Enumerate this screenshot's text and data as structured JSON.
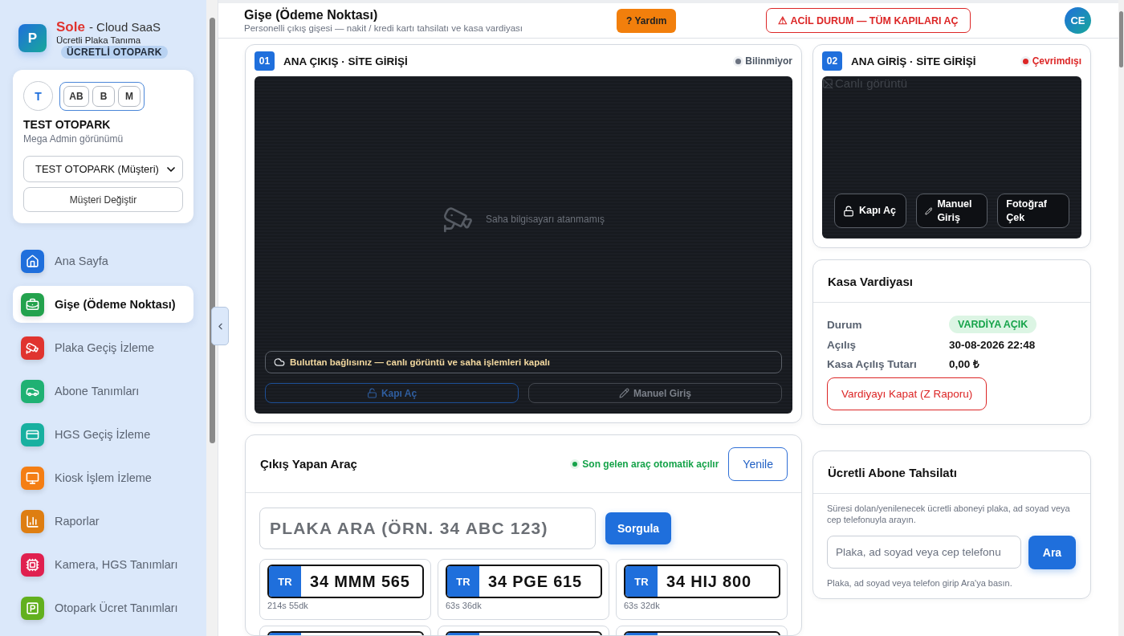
{
  "sidebar": {
    "logo_letter": "P",
    "brand_name": "Sole",
    "brand_suffix": "- Cloud SaaS",
    "product": "Ücretli Plaka Tanıma",
    "plan_badge": "ÜCRETLİ OTOPARK",
    "account": {
      "avatar": "T",
      "view_buttons": [
        "AB",
        "B",
        "M"
      ],
      "view_switch_active": true,
      "title": "TEST OTOPARK",
      "subtitle": "Mega Admin görünümü",
      "customer_select": {
        "value": "TEST OTOPARK (Müşteri)"
      },
      "change_button": "Müşteri Değiştir"
    },
    "nav": [
      {
        "label": "Ana Sayfa",
        "color": "#1f6fdc",
        "selected": false
      },
      {
        "label": "Gişe (Ödeme Noktası)",
        "color": "#23a24d",
        "selected": true
      },
      {
        "label": "Plaka Geçiş İzleme",
        "color": "#e0342f",
        "selected": false
      },
      {
        "label": "Abone Tanımları",
        "color": "#1fb173",
        "selected": false
      },
      {
        "label": "HGS Geçiş İzleme",
        "color": "#18b0a0",
        "selected": false
      },
      {
        "label": "Kiosk İşlem İzleme",
        "color": "#f47e14",
        "selected": false
      },
      {
        "label": "Raporlar",
        "color": "#de7e12",
        "selected": false
      },
      {
        "label": "Kamera, HGS Tanımları",
        "color": "#e0204f",
        "selected": false
      },
      {
        "label": "Otopark Ücret Tanımları",
        "color": "#62b01e",
        "selected": false
      }
    ]
  },
  "header": {
    "title": "Gişe (Ödeme Noktası)",
    "subtitle": "Personelli çıkış gişesi — nakit / kredi kartı tahsilatı ve kasa vardiyası",
    "help_button": "? Yardım",
    "emergency_button": "⚠ ACİL DURUM — TÜM KAPILARI AÇ",
    "user_avatar": "CE"
  },
  "cameras": [
    {
      "number": "01",
      "name": "ANA ÇIKIŞ · SİTE GİRİŞİ",
      "status": {
        "label": "Bilinmiyor",
        "color": "#6b7280"
      },
      "feed": {
        "kind": "placeholder",
        "message": "Saha bilgisayarı atanmamış"
      },
      "notice": "Buluttan bağlısınız — canlı görüntü ve saha işlemleri kapalı",
      "actions": [
        {
          "label": "Kapı Aç",
          "kind": "open",
          "disabled": true
        },
        {
          "label": "Manuel Giriş",
          "kind": "manual",
          "disabled": true
        }
      ]
    },
    {
      "number": "02",
      "name": "ANA GİRİŞ · SİTE GİRİŞİ",
      "status": {
        "label": "Çevrimdışı",
        "color": "#dc2626"
      },
      "feed": {
        "kind": "broken",
        "alt": "Canlı görüntü"
      },
      "actions": [
        {
          "label": "Kapı Aç",
          "kind": "open",
          "disabled": false
        },
        {
          "label": "Manuel Giriş",
          "kind": "manual",
          "disabled": false
        },
        {
          "label": "Fotoğraf Çek",
          "kind": "photo",
          "disabled": false
        }
      ]
    }
  ],
  "exit_vehicle": {
    "title": "Çıkış Yapan Araç",
    "auto_note": "Son gelen araç otomatik açılır",
    "refresh_button": "Yenile",
    "search": {
      "placeholder": "PLAKA ARA (ÖRN. 34 ABC 123)"
    },
    "query_button": "Sorgula",
    "plates": [
      {
        "kind": "full",
        "country": "TR",
        "number": "34 MMM 565",
        "elapsed": "214s 55dk"
      },
      {
        "kind": "full",
        "country": "TR",
        "number": "34 PGE 615",
        "elapsed": "63s 36dk"
      },
      {
        "kind": "full",
        "country": "TR",
        "number": "34 HIJ 800",
        "elapsed": "63s 32dk"
      },
      {
        "kind": "cut"
      },
      {
        "kind": "cut"
      },
      {
        "kind": "cut"
      }
    ]
  },
  "cash_shift": {
    "title": "Kasa Vardiyası",
    "rows": [
      {
        "label": "Durum",
        "value": "VARDİYA AÇIK",
        "kind": "badge"
      },
      {
        "label": "Açılış",
        "value": "30-08-2026 22:48",
        "kind": "text"
      },
      {
        "label": "Kasa Açılış Tutarı",
        "value": "0,00 ₺",
        "kind": "text"
      }
    ],
    "close_button": "Vardiyayı Kapat (Z Raporu)"
  },
  "subscriber_payment": {
    "title": "Ücretli Abone Tahsilatı",
    "hint": "Süresi dolan/yenilenecek ücretli aboneyi plaka, ad soyad veya cep telefonuyla arayın.",
    "search": {
      "placeholder": "Plaka, ad soyad veya cep telefonu"
    },
    "search_button": "Ara",
    "footer": "Plaka, ad soyad veya telefon girip Ara'ya basın."
  }
}
